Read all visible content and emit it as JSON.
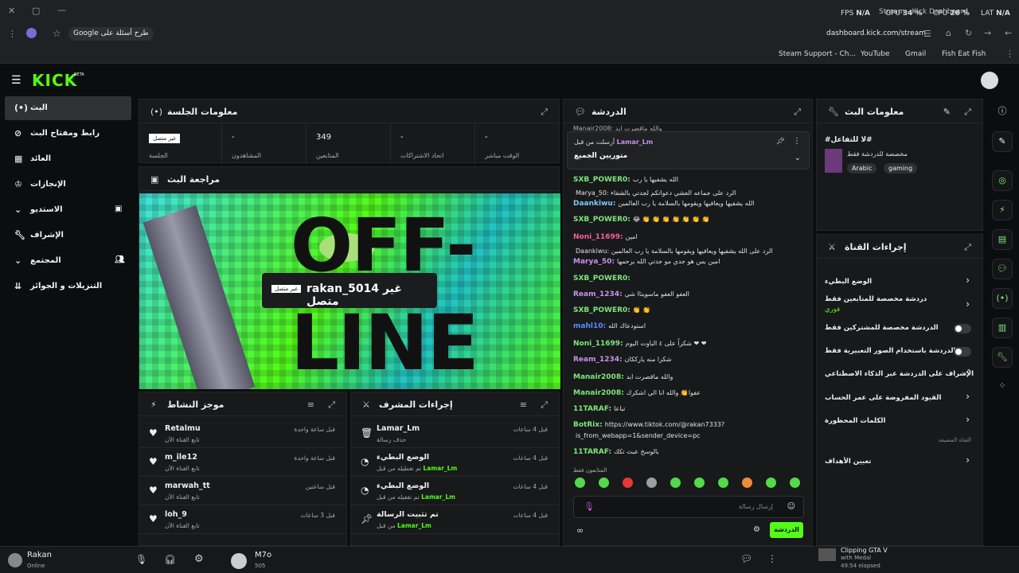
{
  "browser": {
    "perf": {
      "fps_label": "FPS",
      "fps": "N/A",
      "gpu_label": "GPU",
      "gpu": "34 %",
      "cpu_label": "CPU",
      "cpu": "26 %",
      "lat_label": "LAT",
      "lat": "N/A"
    },
    "tab_title": "Stream - Kick Dashboard",
    "google_pill": "Google طرح أسئلة على",
    "url": "dashboard.kick.com/stream",
    "bookmarks": [
      "Steam Support - Ch...",
      "YouTube",
      "Gmail",
      "Fish Eat Fish"
    ]
  },
  "brand": {
    "logo": "KICK",
    "beta": "BETA"
  },
  "sidebar": {
    "items": [
      {
        "label": "البث",
        "icon": "live-icon",
        "active": true
      },
      {
        "label": "رابط ومفتاح البث",
        "icon": "link-icon"
      },
      {
        "label": "العائد",
        "icon": "revenue-icon"
      },
      {
        "label": "الإنجازات",
        "icon": "trophy-icon"
      },
      {
        "label": "الاستديو",
        "icon": "studio-icon"
      },
      {
        "label": "الإشراف",
        "icon": "wrench-icon"
      },
      {
        "label": "المجتمع",
        "icon": "community-icon"
      },
      {
        "label": "التنزيلات و الجوائز",
        "icon": "downloads-icon"
      }
    ]
  },
  "session": {
    "title": "معلومات الجلسة",
    "stats": [
      {
        "value": "غير متصل",
        "label": "الجلسة"
      },
      {
        "value": "-",
        "label": "المشاهدون"
      },
      {
        "value": "349",
        "label": "المتابعين"
      },
      {
        "value": "-",
        "label": "اتحاد الاشتراكات"
      },
      {
        "value": "-",
        "label": "الوقت مباشر"
      }
    ]
  },
  "preview": {
    "title": "مراجعة البث",
    "offline_badge": "غير متصل",
    "offline_text": "rakan_5014 غير متصل",
    "big_text_1": "OFF-",
    "big_text_2": "LINE"
  },
  "activity": {
    "title": "موجز النشاط",
    "rows": [
      {
        "name": "Retalmu",
        "sub": "تابع القناة الآن",
        "time": "قبل ساعة واحدة"
      },
      {
        "name": "m_ile12",
        "sub": "تابع القناة الآن",
        "time": "قبل ساعة واحدة"
      },
      {
        "name": "marwah_tt",
        "sub": "تابع القناة الآن",
        "time": "قبل ساعتين"
      },
      {
        "name": "loh_9",
        "sub": "تابع القناة الآن",
        "time": "قبل 3 ساعات"
      }
    ]
  },
  "modlog": {
    "title": "إجراءات المشرف",
    "rows": [
      {
        "name": "Lamar_Lm",
        "sub": "حذف رسالة",
        "time": "قبل 4 ساعات"
      },
      {
        "name": "الوضع البطيء",
        "sub": "تم تعطيله من قبل",
        "by": "Lamar_Lm",
        "time": "قبل 4 ساعات"
      },
      {
        "name": "الوضع البطيء",
        "sub": "تم تفعيله من قبل",
        "by": "Lamar_Lm",
        "time": "قبل 4 ساعات"
      },
      {
        "name": "تم تثبيت الرسالة",
        "sub": "من قبل",
        "by": "Lamar_Lm",
        "time": "قبل 4 ساعات"
      }
    ]
  },
  "chat": {
    "title": "الدردشة",
    "pinned_by_label": "أرسلت من قبل",
    "pinned_user": "Lamar_Lm",
    "pinned_text": "متوريين الجميع",
    "top_partial": "Manair2008: والله ماقصرت ابد",
    "messages": [
      {
        "user": "SXB_POWER0:",
        "color": "#7ee67e",
        "text": "الله يشفيها يا رب"
      },
      {
        "user": "",
        "color": "#aaa",
        "text": "Marya_50: الرد على   جماعه العشي دعواتكم لجدتي بالشفاء"
      },
      {
        "user": "Daankiwu:",
        "color": "#7ec8ff",
        "text": "الله يشفيها ويعافيها ويقومها بالسلامة يا رب العالمين"
      },
      {
        "user": "SXB_POWER0:",
        "color": "#7ee67e",
        "text": "😂 👏 👏 👏 👏 👏 👏 👏"
      },
      {
        "user": "Noni_11699:",
        "color": "#f06292",
        "text": "امين"
      },
      {
        "user": "",
        "color": "#aaa",
        "text": "Daankiwu: الرد على   الله يشفيها ويعافيها ويقومها بالسلامة يا رب العالمين"
      },
      {
        "user": "Marya_50:",
        "color": "#c792ea",
        "text": "امين بس هو جدي مو جدتي الله يرحمها"
      },
      {
        "user": "SXB_POWER0:",
        "color": "#7ee67e",
        "text": ""
      },
      {
        "user": "Ream_1234:",
        "color": "#c792ea",
        "text": "العفو العفو ماسويناا شي"
      },
      {
        "user": "SXB_POWER0:",
        "color": "#7ee67e",
        "text": "👏 👏"
      },
      {
        "user": "mahl10:",
        "color": "#5c8bff",
        "text": "استودعاك الله"
      },
      {
        "user": "Noni_11699:",
        "color": "#7ee67e",
        "text": "شكراً على ٤ الباوت اليوم ❤ ❤"
      },
      {
        "user": "Ream_1234:",
        "color": "#c792ea",
        "text": "شكرا منه يارككان"
      },
      {
        "user": "Manair2008:",
        "color": "#7ee67e",
        "text": "والله ماقصرت ابد"
      },
      {
        "user": "Manair2008:",
        "color": "#7ee67e",
        "text": "عفوا👏 والله انا الي اشكرك"
      },
      {
        "user": "11TARAF:",
        "color": "#7ee67e",
        "text": "تباعا"
      },
      {
        "user": "BotRix:",
        "color": "#7ee67e",
        "text": "https://www.tiktok.com/@rakan7333?"
      },
      {
        "user": "",
        "color": "#7ec8ff",
        "text": "is_from_webapp=1&sender_device=pc"
      },
      {
        "user": "11TARAF:",
        "color": "#7ee67e",
        "text": "بالوسخ عبث تكك"
      }
    ],
    "followers_only": "المتابعون فقط",
    "input_placeholder": "إرسال رسالة",
    "send_button": "الدردشة"
  },
  "stream_info": {
    "title": "معلومات البث",
    "stream_title": "#لا للتفاعل#",
    "category": "مخصصة للدردشة فقط",
    "tags": [
      "Arabic",
      "gaming"
    ]
  },
  "channel_actions": {
    "title": "إجراءات القناة",
    "items": [
      {
        "label": "الوضع البطيء",
        "type": "arrow"
      },
      {
        "label": "دردشة مخصصة للمتابعين فقط",
        "sub": "فوري",
        "type": "arrow"
      },
      {
        "label": "الدردشة مخصصة للمشتركين فقط",
        "type": "toggle"
      },
      {
        "label": "الدردشة باستخدام الصور التعبيرية فقط",
        "type": "toggle"
      },
      {
        "label": "الإشراف على الدردشة عبر الذكاء الاصطناعي",
        "type": "external"
      },
      {
        "label": "القيود المفروضة على عمر الحساب",
        "type": "arrow"
      },
      {
        "label": "الكلمات المحظورة",
        "type": "arrow"
      }
    ],
    "section_label": "القناة المضيفة",
    "host_item": "تعيين الأهداف"
  },
  "taskbar": {
    "user": "Rakan",
    "status": "Online",
    "friend": "M7o",
    "friend_count": "505",
    "clip_title": "Clipping GTA V",
    "clip_sub": "with Medal",
    "clip_time": "49:54 elapsed"
  }
}
